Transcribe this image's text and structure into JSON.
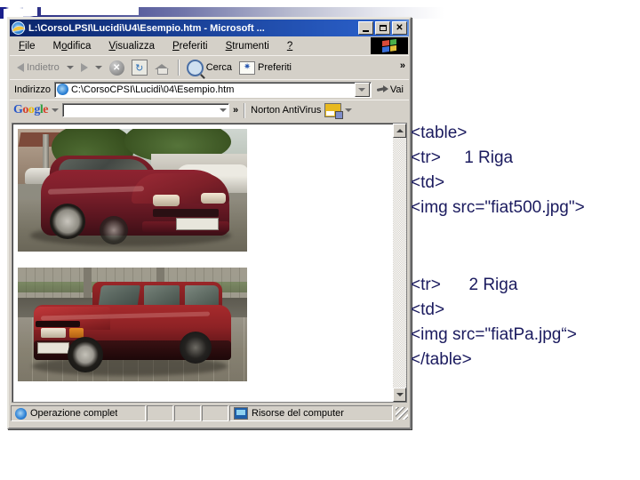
{
  "window": {
    "title": "L:\\CorsoLPSI\\Lucidi\\U4\\Esempio.htm - Microsoft ...",
    "controls": {
      "minimize": "_",
      "maximize": "□",
      "close": "×"
    }
  },
  "menu": {
    "items": [
      {
        "label": "File",
        "accel": "F"
      },
      {
        "label": "Modifica",
        "accel": "M"
      },
      {
        "label": "Visualizza",
        "accel": "V"
      },
      {
        "label": "Preferiti",
        "accel": "P"
      },
      {
        "label": "Strumenti",
        "accel": "S"
      },
      {
        "label": "?",
        "accel": "?"
      }
    ]
  },
  "toolbar": {
    "back": "Indietro",
    "forward": "",
    "stop": "",
    "refresh": "",
    "home": "",
    "search": "Cerca",
    "favorites": "Preferiti",
    "overflow": "»"
  },
  "address": {
    "label": "Indirizzo",
    "value": "C:\\CorsoCPSI\\Lucidi\\04\\Esempio.htm",
    "placeholder": "",
    "go_label": "Vai"
  },
  "google_bar": {
    "logo": "Google",
    "logo_letters": [
      "G",
      "o",
      "o",
      "g",
      "l",
      "e"
    ],
    "search_value": "",
    "search_placeholder": "",
    "overflow": "»",
    "norton_label": "Norton AntiVirus"
  },
  "page_content": {
    "image_1_alt": "fiat500.jpg",
    "image_2_alt": "fiatPa.jpg"
  },
  "statusbar": {
    "status": "Operazione complet",
    "zone": "Risorse del computer"
  },
  "code": {
    "block_1": "<table>\n<tr>     1 Riga\n<td>\n<img src=\"fiat500.jpg\">",
    "block_2": "<tr>      2 Riga\n<td>\n<img src=\"fiatPa.jpg“>\n</table>"
  },
  "colors": {
    "title_bar": "#0a246a",
    "window_face": "#d4d0c8",
    "code_text": "#1a1a5e",
    "deco_bar": "#2b2f86"
  }
}
